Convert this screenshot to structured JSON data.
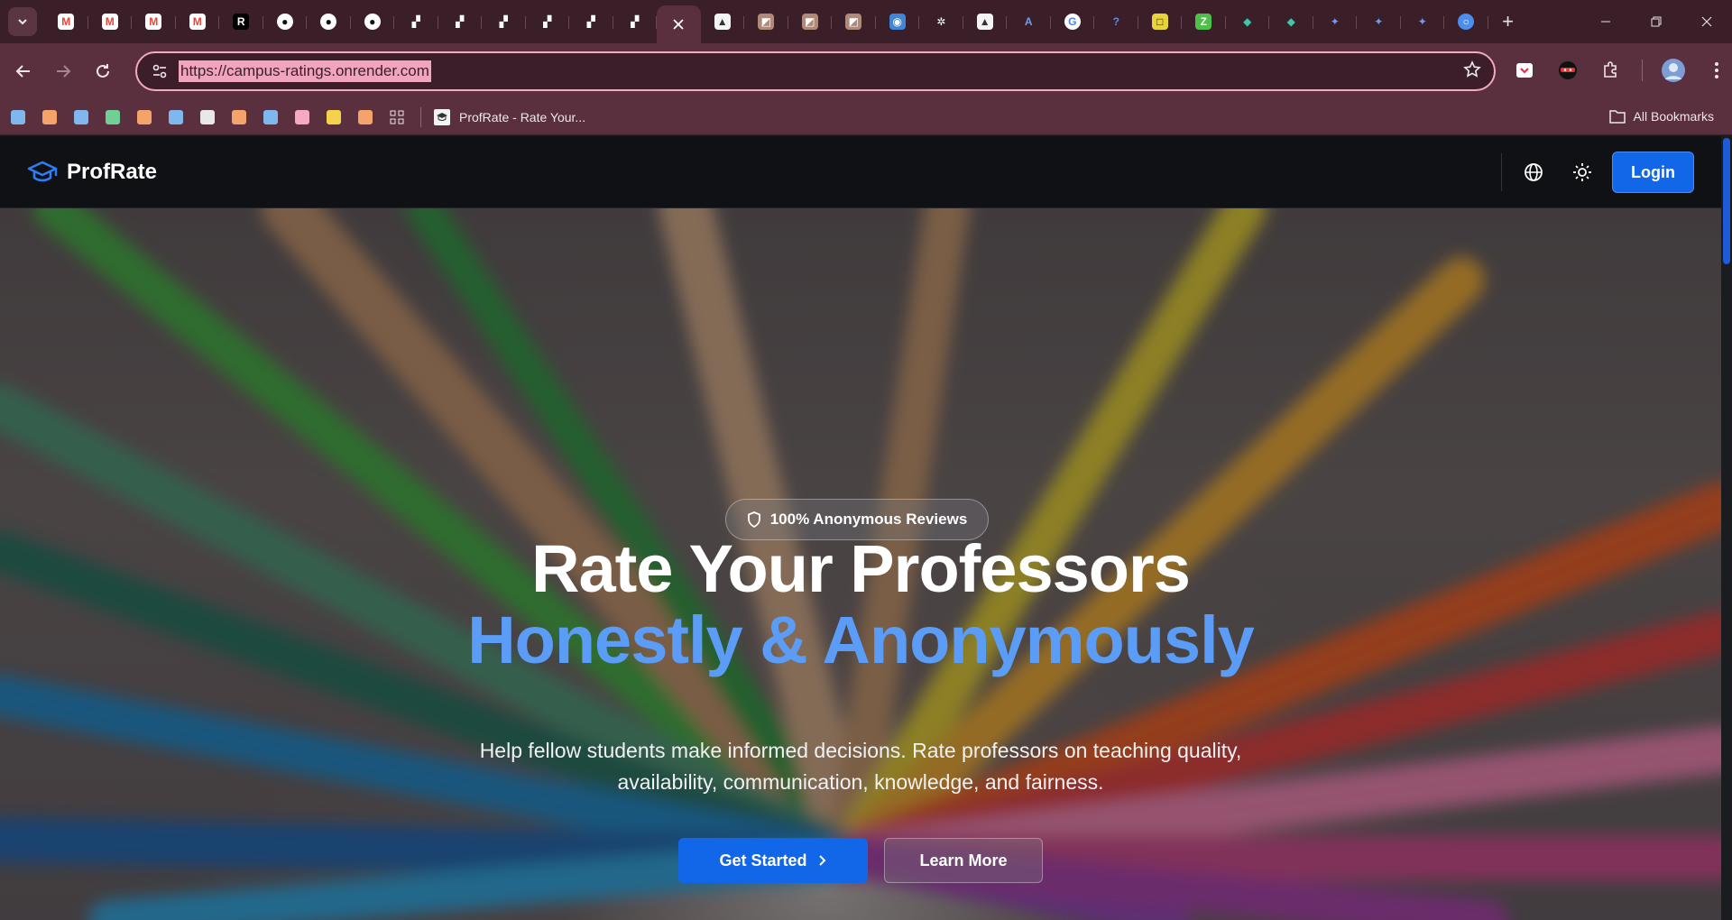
{
  "browser": {
    "tabs": [
      {
        "icon": "tab-list-icon"
      },
      {
        "icon": "gmail-icon",
        "color": "#ea4335"
      },
      {
        "icon": "gmail-icon",
        "color": "#ea4335"
      },
      {
        "icon": "gmail-icon",
        "color": "#ea4335"
      },
      {
        "icon": "gmail-icon",
        "color": "#ea4335"
      },
      {
        "icon": "r-logo-icon"
      },
      {
        "icon": "github-icon"
      },
      {
        "icon": "github-icon"
      },
      {
        "icon": "github-icon"
      },
      {
        "icon": "zigzag-icon"
      },
      {
        "icon": "zigzag-icon"
      },
      {
        "icon": "zigzag-icon"
      },
      {
        "icon": "zigzag-icon"
      },
      {
        "icon": "zigzag-icon"
      },
      {
        "icon": "zigzag-icon"
      },
      {
        "icon": "close-icon",
        "active": true
      },
      {
        "icon": "profrate-favicon"
      },
      {
        "icon": "photo-favicon"
      },
      {
        "icon": "photo-favicon"
      },
      {
        "icon": "photo-favicon"
      },
      {
        "icon": "eye-favicon"
      },
      {
        "icon": "openai-icon"
      },
      {
        "icon": "profrate-favicon"
      },
      {
        "icon": "triangle-a-icon"
      },
      {
        "icon": "google-icon"
      },
      {
        "icon": "question-icon"
      },
      {
        "icon": "yellow-box-icon"
      },
      {
        "icon": "green-z-icon"
      },
      {
        "icon": "tag-icon"
      },
      {
        "icon": "tag-icon"
      },
      {
        "icon": "gemini-icon"
      },
      {
        "icon": "gemini-icon"
      },
      {
        "icon": "gemini-icon"
      },
      {
        "icon": "circle-icon"
      }
    ],
    "url": "https://campus-ratings.onrender.com",
    "bookmark_colors": [
      "#7fb7ee",
      "#f4a46b",
      "#7fb7ee",
      "#6fcf97",
      "#f4a46b",
      "#7fb7ee",
      "#e8e8e8",
      "#f4a46b",
      "#7fb7ee",
      "#f7a8c4",
      "#f2d34b",
      "#f4a46b"
    ],
    "bookmark_tab_label": "ProfRate - Rate Your...",
    "all_bookmarks_label": "All Bookmarks"
  },
  "header": {
    "brand": "ProfRate",
    "login_label": "Login"
  },
  "hero": {
    "badge": "100% Anonymous Reviews",
    "title_line1": "Rate Your Professors",
    "title_line2": "Honestly & Anonymously",
    "subtitle": "Help fellow students make informed decisions. Rate professors on teaching quality, availability, communication, knowledge, and fairness.",
    "cta_primary": "Get Started",
    "cta_secondary": "Learn More"
  },
  "colors": {
    "accent": "#1266e8",
    "highlight_text": "#5b9cf6",
    "chrome": "#5a2f3e"
  }
}
